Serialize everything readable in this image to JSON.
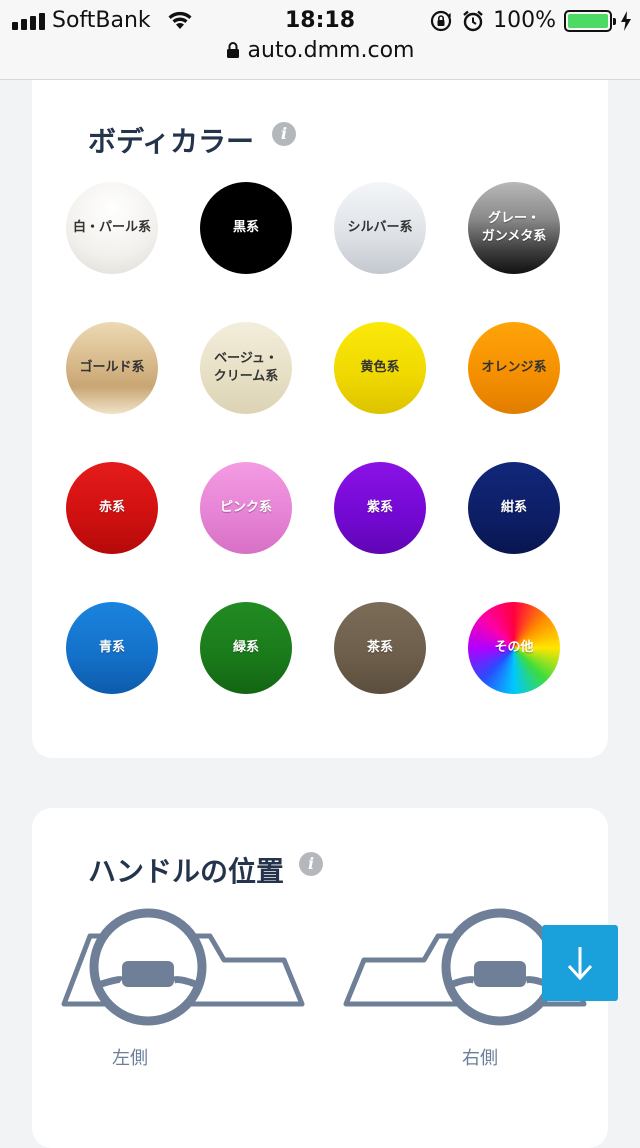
{
  "status_bar": {
    "carrier": "SoftBank",
    "time": "18:18",
    "battery_percent": "100%",
    "battery_level": 1.0,
    "url": "auto.dmm.com"
  },
  "body_color": {
    "title": "ボディカラー",
    "colors": [
      {
        "label": "白・パール系",
        "text_color": "#333333",
        "bg": "radial-gradient(circle at 50% 30%, #ffffff 0%, #f2f0ec 60%, #dcd9d3 100%)"
      },
      {
        "label": "黒系",
        "text_color": "#ffffff",
        "bg": "#000000"
      },
      {
        "label": "シルバー系",
        "text_color": "#333333",
        "bg": "linear-gradient(180deg, #f4f6f8 0%, #dde1e6 60%, #c3c8ce 100%)"
      },
      {
        "label": "グレー・\nガンメタ系",
        "text_color": "#ffffff",
        "bg": "linear-gradient(180deg, #b8b8b8 0%, #8a8a8a 40%, #3c3c3c 75%, #111111 100%)"
      },
      {
        "label": "ゴールド系",
        "text_color": "#333333",
        "bg": "linear-gradient(180deg, #ecd9b4 0%, #d7b98a 45%, #c9a673 70%, #efe3c8 100%)"
      },
      {
        "label": "ベージュ・\nクリーム系",
        "text_color": "#333333",
        "bg": "linear-gradient(180deg, #f3eedc 0%, #e6dfc4 60%, #dcd3b4 100%)"
      },
      {
        "label": "黄色系",
        "text_color": "#333333",
        "bg": "linear-gradient(180deg, #fbe90a 0%, #efd800 60%, #dcc300 100%)"
      },
      {
        "label": "オレンジ系",
        "text_color": "#333333",
        "bg": "linear-gradient(180deg, #ffa40a 0%, #f59100 55%, #e17d00 100%)"
      },
      {
        "label": "赤系",
        "text_color": "#ffffff",
        "bg": "linear-gradient(180deg, #e51b1b 0%, #cf1010 60%, #b40a0a 100%)"
      },
      {
        "label": "ピンク系",
        "text_color": "#ffffff",
        "bg": "linear-gradient(180deg, #f49be3 0%, #e582d4 60%, #d670c4 100%)"
      },
      {
        "label": "紫系",
        "text_color": "#ffffff",
        "bg": "linear-gradient(180deg, #8a12e6 0%, #7308d2 60%, #5f06b4 100%)"
      },
      {
        "label": "紺系",
        "text_color": "#ffffff",
        "bg": "linear-gradient(180deg, #12277a 0%, #0d1e66 60%, #081550 100%)"
      },
      {
        "label": "青系",
        "text_color": "#ffffff",
        "bg": "linear-gradient(180deg, #1a84de 0%, #1470c8 60%, #0d5bab 100%)"
      },
      {
        "label": "緑系",
        "text_color": "#ffffff",
        "bg": "linear-gradient(180deg, #228b22 0%, #1a7a1a 60%, #136513 100%)"
      },
      {
        "label": "茶系",
        "text_color": "#ffffff",
        "bg": "linear-gradient(180deg, #7b6c58 0%, #6d5e4b 60%, #5c4e3d 100%)"
      },
      {
        "label": "その他",
        "text_color": "#ffffff",
        "bg": "conic-gradient(#ff0040, #ff8a00, #ffe600, #3ddc3d, #00c8ff, #2a4bff, #b000ff, #ff00a8, #ff0040)"
      }
    ]
  },
  "handle_position": {
    "title": "ハンドルの位置",
    "options": [
      {
        "label": "左側"
      },
      {
        "label": "右側"
      }
    ]
  },
  "colors": {
    "title_text": "#24344d",
    "handle_icon": "#6e7f97",
    "scroll_button": "#1aa0db",
    "card_bg": "#ffffff",
    "page_bg": "#f2f3f5"
  },
  "icons": {
    "info": "info-icon",
    "scroll": "arrow-down-icon"
  }
}
